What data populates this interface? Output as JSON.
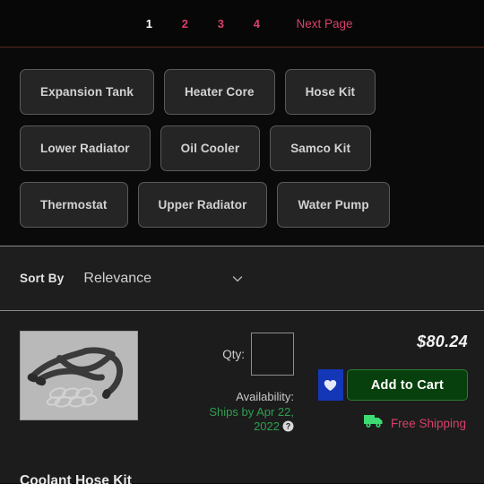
{
  "pagination": {
    "pages": [
      {
        "label": "1",
        "active": true
      },
      {
        "label": "2",
        "active": false
      },
      {
        "label": "3",
        "active": false
      },
      {
        "label": "4",
        "active": false
      }
    ],
    "next_label": "Next Page",
    "active_color": "#ffffff",
    "link_color": "#d9406a"
  },
  "categories": {
    "rows": [
      [
        "Expansion Tank",
        "Heater Core",
        "Hose Kit"
      ],
      [
        "Lower Radiator",
        "Oil Cooler",
        "Samco Kit"
      ],
      [
        "Thermostat",
        "Upper Radiator",
        "Water Pump"
      ]
    ]
  },
  "sort": {
    "label": "Sort By",
    "value": "Relevance",
    "chevron_icon": "chevron-down-icon"
  },
  "product": {
    "image_alt": "coolant-hose-kit-photo",
    "qty_label": "Qty:",
    "qty_value": "",
    "qty_placeholder": "",
    "availability_label": "Availability:",
    "ships_text": "Ships by Apr 22, 2022",
    "ships_color": "#2f9e4f",
    "help_icon": "question-mark-circle-icon",
    "price": "$80.24",
    "wishlist_icon": "heart-icon",
    "wishlist_color": "#1437b8",
    "add_to_cart_label": "Add to Cart",
    "add_to_cart_color": "#07400c",
    "shipping_icon": "delivery-truck-icon",
    "shipping_text": "Free Shipping",
    "shipping_text_color": "#d9406a",
    "title": "Coolant Hose Kit"
  }
}
